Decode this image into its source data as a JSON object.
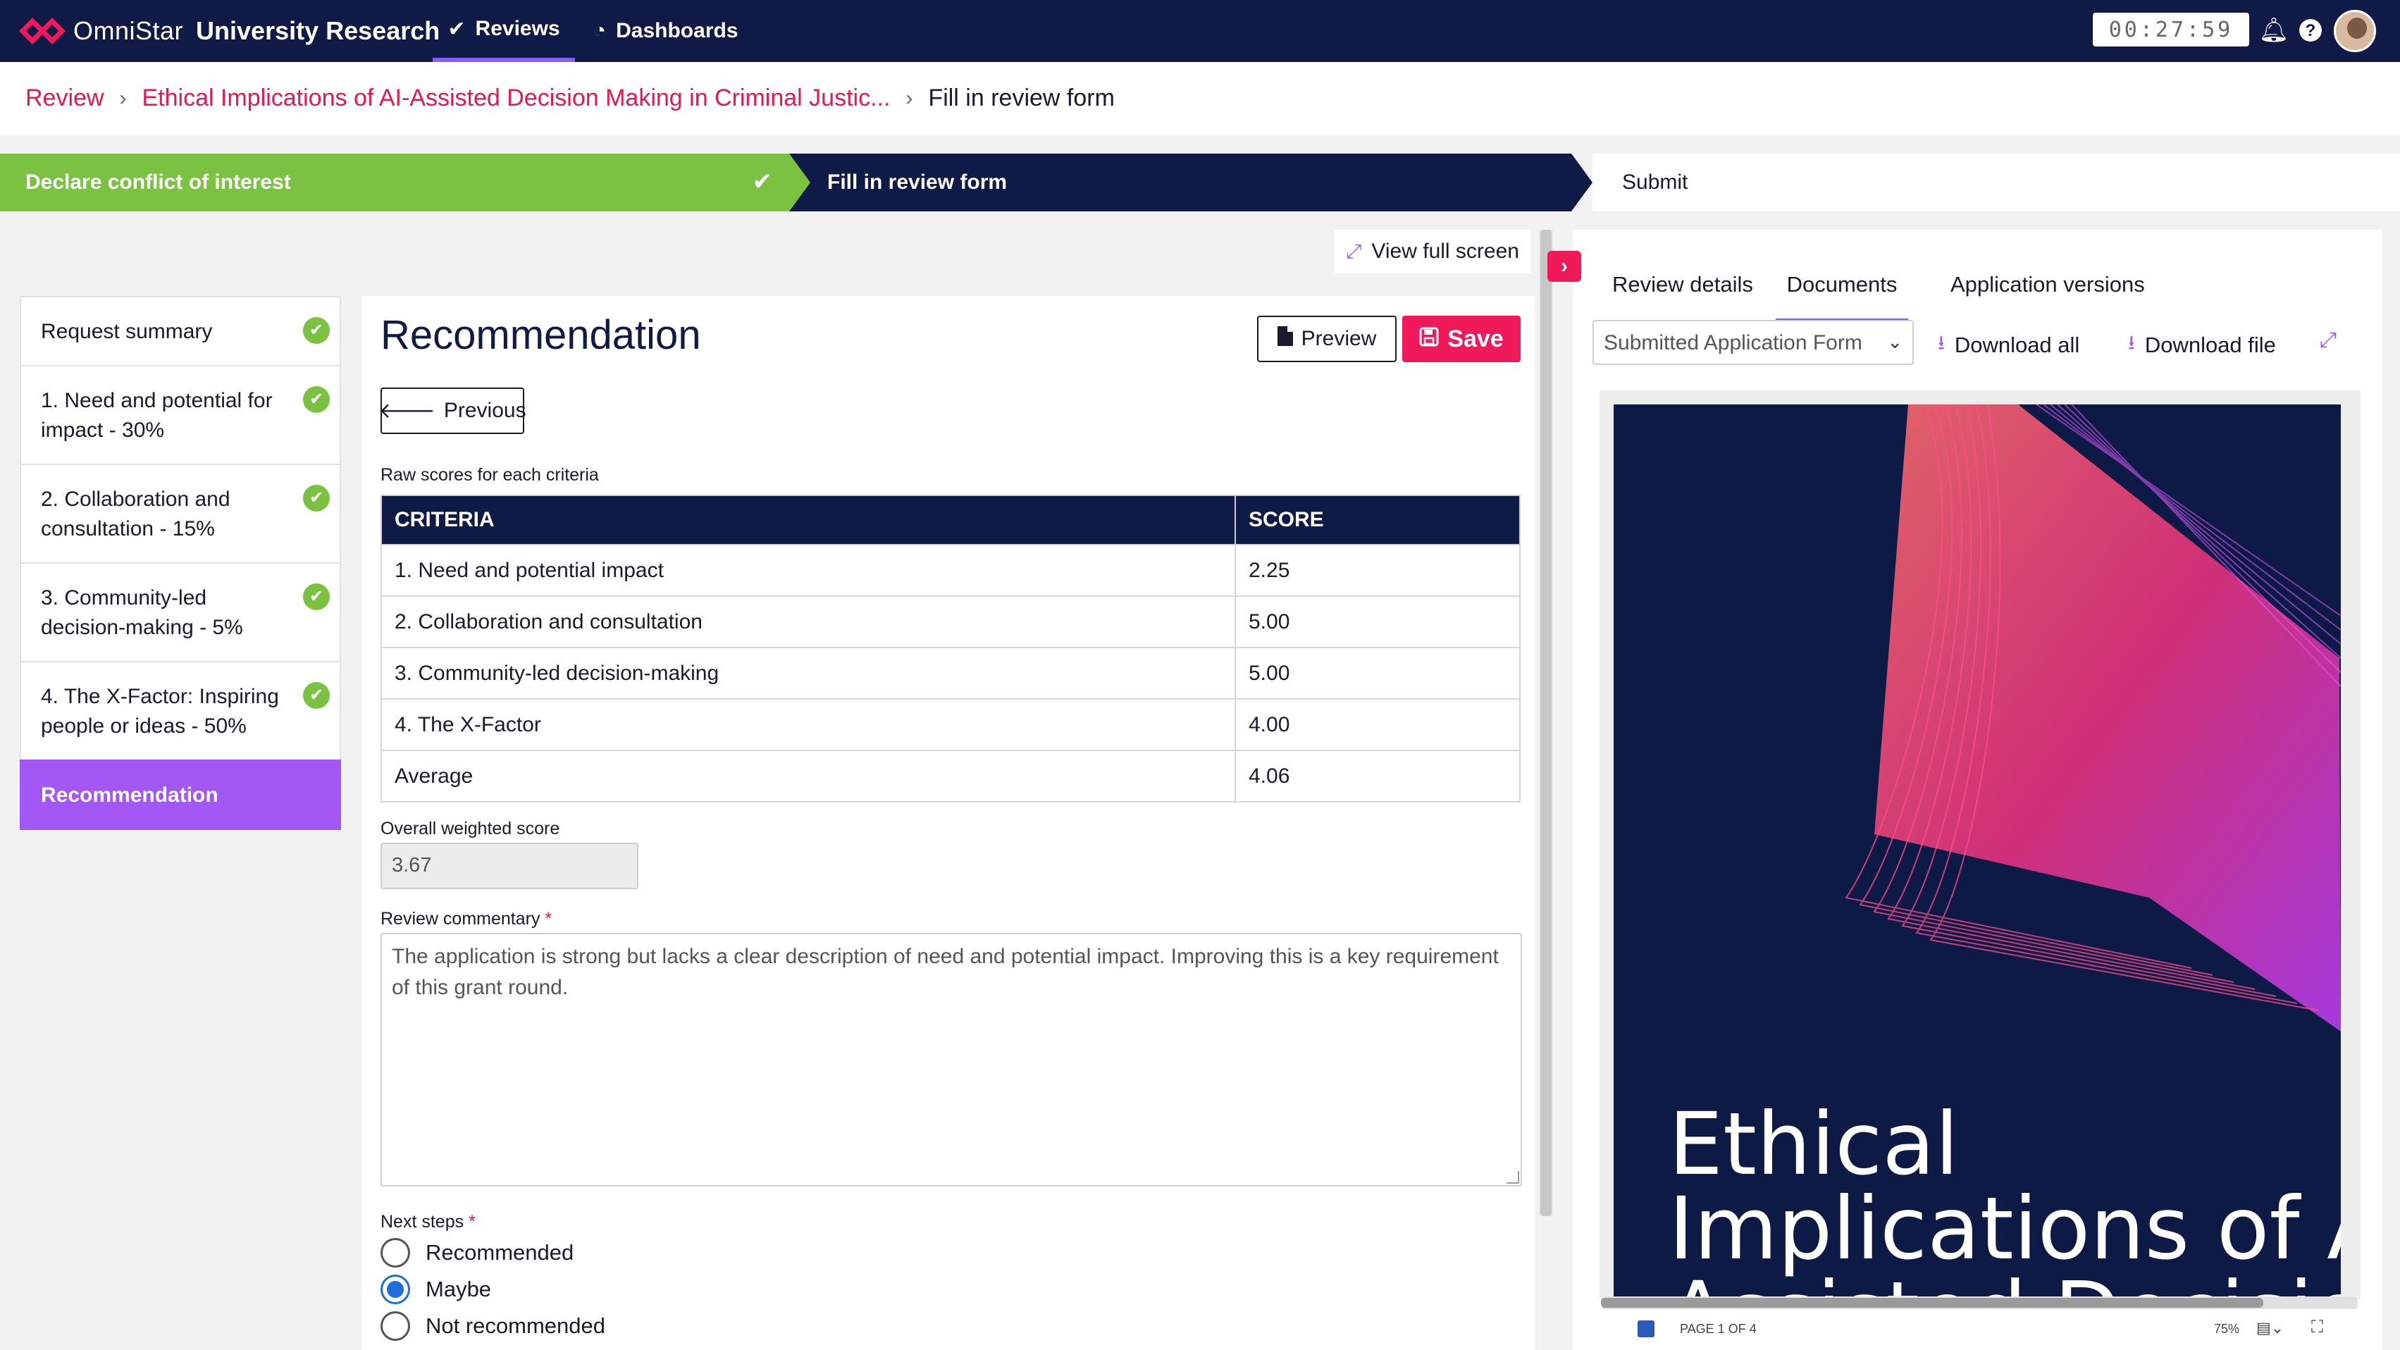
{
  "topbar": {
    "brand": "OmniStar",
    "org": "University Research",
    "nav": [
      {
        "label": "Reviews",
        "icon": "check-icon"
      },
      {
        "label": "Dashboards",
        "icon": "dashboard-icon"
      }
    ],
    "timer": "00:27:59",
    "icons": [
      "bell-icon",
      "help-icon",
      "avatar"
    ]
  },
  "breadcrumb": {
    "items": [
      "Review",
      "Ethical Implications of AI-Assisted Decision Making in Criminal Justic..."
    ],
    "current": "Fill in review form"
  },
  "stepper": {
    "steps": [
      {
        "label": "Declare conflict of interest",
        "state": "complete"
      },
      {
        "label": "Fill in review form",
        "state": "current"
      },
      {
        "label": "Submit",
        "state": "pending"
      }
    ]
  },
  "sidebar": {
    "items": [
      {
        "label": "Request summary",
        "done": true
      },
      {
        "label": "1. Need and potential for impact - 30%",
        "done": true
      },
      {
        "label": "2. Collaboration and consultation - 15%",
        "done": true
      },
      {
        "label": "3. Community-led decision-making - 5%",
        "done": true
      },
      {
        "label": "4. The X-Factor: Inspiring people or ideas - 50%",
        "done": true
      },
      {
        "label": "Recommendation",
        "done": false
      }
    ]
  },
  "main": {
    "fullscreen_label": "View full screen",
    "title": "Recommendation",
    "preview_label": "Preview",
    "save_label": "Save",
    "previous_label": "Previous",
    "table_caption": "Raw scores for each criteria",
    "table_headers": [
      "CRITERIA",
      "SCORE"
    ],
    "table_rows": [
      [
        "1. Need and potential impact",
        "2.25"
      ],
      [
        "2. Collaboration and consultation",
        "5.00"
      ],
      [
        "3. Community-led decision-making",
        "5.00"
      ],
      [
        "4. The X-Factor",
        "4.00"
      ],
      [
        "Average",
        "4.06"
      ]
    ],
    "weighted_label": "Overall weighted score",
    "weighted_value": "3.67",
    "commentary_label": "Review commentary",
    "commentary_value": "The application is strong but lacks a clear description of need and potential impact.  Improving this is a key requirement of this grant round.",
    "next_steps_label": "Next steps",
    "next_steps_options": [
      "Recommended",
      "Maybe",
      "Not recommended"
    ],
    "next_steps_selected": "Maybe"
  },
  "right_panel": {
    "tabs": [
      "Review details",
      "Documents",
      "Application versions"
    ],
    "active_tab": "Documents",
    "document_select": "Submitted Application Form",
    "download_all_label": "Download all",
    "download_file_label": "Download file",
    "document_title_lines": [
      "Ethical",
      "Implications of A",
      "Assisted Decisio"
    ],
    "status_page": "PAGE 1 OF 4",
    "zoom": "75%"
  },
  "colors": {
    "navy": "#0f1a47",
    "green": "#7cc242",
    "accent_pink": "#f0195a",
    "link_red": "#e5194f",
    "purple": "#a357f5"
  }
}
